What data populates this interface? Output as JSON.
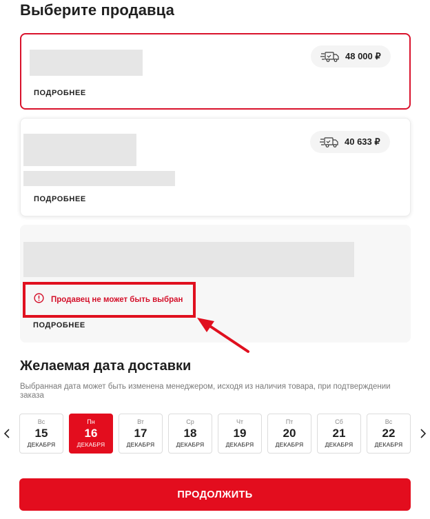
{
  "colors": {
    "accent": "#e30d1e",
    "error": "#d4102a"
  },
  "header": {
    "title": "Выберите продавца"
  },
  "sellers": [
    {
      "price": "48 000 ₽",
      "details_label": "ПОДРОБНЕЕ",
      "selected": true,
      "icon": "delivery-truck-icon"
    },
    {
      "price": "40 633 ₽",
      "details_label": "ПОДРОБНЕЕ",
      "selected": false,
      "icon": "delivery-truck-icon"
    },
    {
      "error": "Продавец не может быть выбран",
      "details_label": "ПОДРОБНЕЕ",
      "selected": false,
      "disabled": true,
      "icon": "alert-circle-icon"
    }
  ],
  "delivery": {
    "title": "Желаемая дата доставки",
    "note": "Выбранная дата может быть изменена менеджером, исходя из наличия товара, при подтверждении заказа",
    "dates": [
      {
        "dow": "Вс",
        "day": "15",
        "month": "ДЕКАБРЯ"
      },
      {
        "dow": "Пн",
        "day": "16",
        "month": "ДЕКАБРЯ",
        "selected": true
      },
      {
        "dow": "Вт",
        "day": "17",
        "month": "ДЕКАБРЯ"
      },
      {
        "dow": "Ср",
        "day": "18",
        "month": "ДЕКАБРЯ"
      },
      {
        "dow": "Чт",
        "day": "19",
        "month": "ДЕКАБРЯ"
      },
      {
        "dow": "Пт",
        "day": "20",
        "month": "ДЕКАБРЯ"
      },
      {
        "dow": "Сб",
        "day": "21",
        "month": "ДЕКАБРЯ"
      },
      {
        "dow": "Вс",
        "day": "22",
        "month": "ДЕКАБРЯ"
      }
    ]
  },
  "footer": {
    "continue_label": "ПРОДОЛЖИТЬ"
  }
}
